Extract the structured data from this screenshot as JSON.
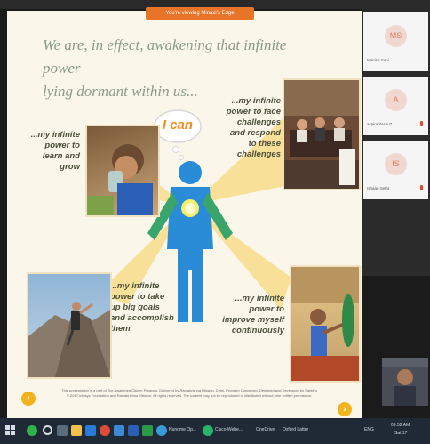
{
  "banner": "You're viewing Minaxi's Edge",
  "slide": {
    "headline_line1": "We are, in effect, awakening that infinite power",
    "headline_line2": "lying dormant within us...",
    "bubble": "I can",
    "captions": {
      "learn": "...my infinite power to learn and grow",
      "face": "...my infinite power to face challenges and respond to these challenges",
      "goals": "...my infinite power to take up big goals and accomplish them",
      "improve": "...my infinite power to improve myself continuously"
    },
    "footer_line1": "This presentation is a part of The Awakened Citizen Program. Delivered by Ramakrishna Mission, Delhi. Program Conceived, Designed and Developed by Sankha",
    "footer_line2": "© 2017 Infosys Foundation and Ramakrishna Mission. All rights reserved. The content may not be reproduced or distributed without prior written permission.",
    "nav_prev": "‹",
    "nav_next": "›"
  },
  "participants": [
    {
      "initials": "MS",
      "name": "Manish Soni",
      "muted": false
    },
    {
      "initials": "A",
      "name": "aspirantashu7",
      "muted": true
    },
    {
      "initials": "IS",
      "name": "Ishaan Sethi",
      "muted": true
    }
  ],
  "taskbar": {
    "app_labels": [
      "Nunome Op...",
      "Cisco Webe...",
      "OneDrive",
      "Oxford Latter"
    ],
    "tray": "ENG",
    "time": "09:52 AM",
    "date": "Sat 17"
  },
  "colors": {
    "figure_blue": "#2a8bd6",
    "ray_yellow": "#f7dc8a",
    "accent_orange": "#e8742a",
    "bubble_text": "#f08a1c"
  }
}
